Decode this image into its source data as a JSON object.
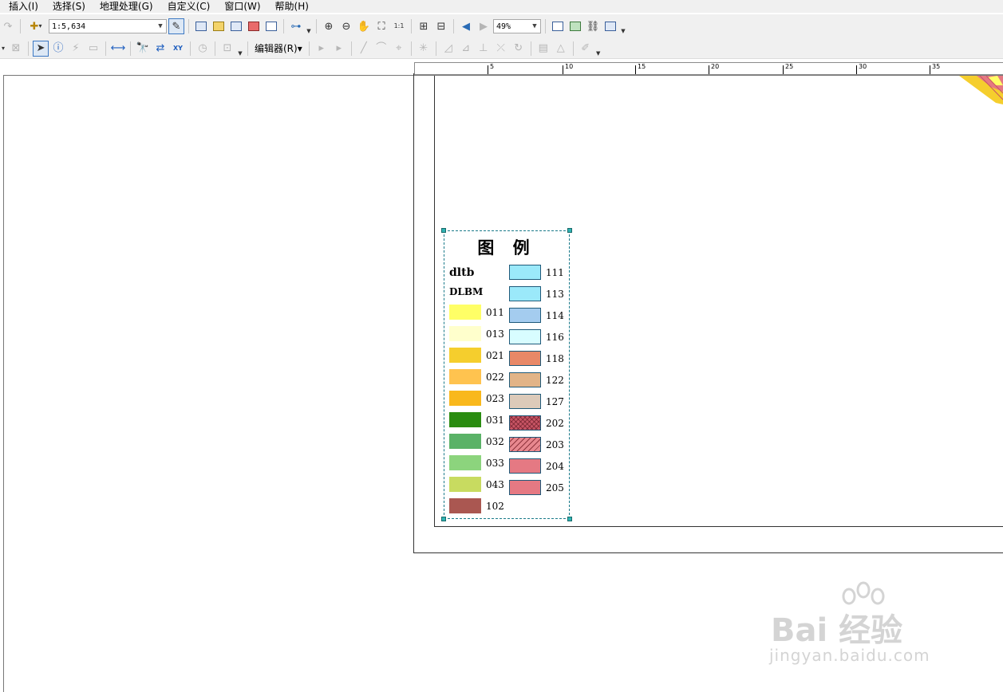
{
  "menu": [
    {
      "label": "插入(I)"
    },
    {
      "label": "选择(S)"
    },
    {
      "label": "地理处理(G)"
    },
    {
      "label": "自定义(C)"
    },
    {
      "label": "窗口(W)"
    },
    {
      "label": "帮助(H)"
    }
  ],
  "toolbar": {
    "scale_value": "1:5,634",
    "zoom_value": "49%",
    "editor_label": "编辑器(R)▾"
  },
  "ruler": {
    "ticks": [
      "5",
      "10",
      "15",
      "20",
      "25",
      "30",
      "35"
    ]
  },
  "legend": {
    "title": "图 例",
    "layer_name": "dltb",
    "field_name": "DLBM",
    "left_items": [
      {
        "label": "011",
        "color": "#FFFF66"
      },
      {
        "label": "013",
        "color": "#FFFFCC"
      },
      {
        "label": "021",
        "color": "#F5CE2D"
      },
      {
        "label": "022",
        "color": "#FFC34F"
      },
      {
        "label": "023",
        "color": "#F9B81C"
      },
      {
        "label": "031",
        "color": "#2A8C10"
      },
      {
        "label": "032",
        "color": "#5AB267"
      },
      {
        "label": "033",
        "color": "#8CD47D"
      },
      {
        "label": "043",
        "color": "#C8DB60"
      },
      {
        "label": "102",
        "color": "#AA5751"
      }
    ],
    "right_items": [
      {
        "label": "111",
        "color": "#9BE9FA"
      },
      {
        "label": "113",
        "color": "#9BE9FA"
      },
      {
        "label": "114",
        "color": "#A4CCEF"
      },
      {
        "label": "116",
        "color": "#D8FDFF"
      },
      {
        "label": "118",
        "color": "#E88867"
      },
      {
        "label": "122",
        "color": "#E2B487"
      },
      {
        "label": "127",
        "color": "#DCCAB9"
      },
      {
        "label": "202",
        "color": "#C85565"
      },
      {
        "label": "203",
        "color": "#E8888F"
      },
      {
        "label": "204",
        "color": "#E57983"
      },
      {
        "label": "205",
        "color": "#E57983"
      }
    ]
  },
  "watermark": {
    "brand": "Bai 经验",
    "url": "jingyan.baidu.com"
  }
}
